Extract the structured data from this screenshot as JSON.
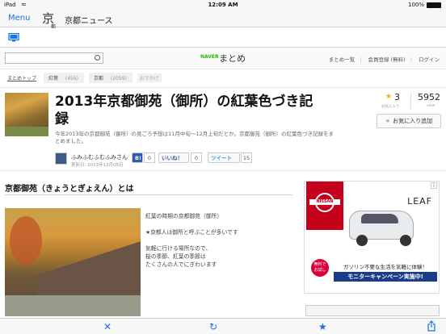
{
  "status": {
    "carrier": "iPad",
    "time": "12:09 AM",
    "battery": "100%"
  },
  "nav": {
    "menu_label": "Menu",
    "logo_char": "京",
    "logo_sub": "都",
    "title": "京都ニュース"
  },
  "naver": {
    "search_placeholder": "",
    "brand": "NAVER",
    "matome": "まとめ",
    "links": [
      "まとめ一覧",
      "会員登録 (無料)",
      "ログイン"
    ]
  },
  "breadcrumb": {
    "top": "まとめトップ",
    "tags": [
      {
        "label": "紅葉",
        "count": "(456)"
      },
      {
        "label": "京都",
        "count": "(2059)"
      }
    ],
    "more": "おでかけ"
  },
  "article": {
    "title": "2013年京都御苑（御所）の紅葉色づき記録",
    "description": "今年2013年の京都御苑（御所）の見ごろ予想は11月中旬〜12月上旬だとか。京都御苑（御所）の紅葉色づき記録をまとめました。",
    "author": "ふみふむふむふみさん",
    "date": "更新日: 2013年12月05日",
    "hatena_label": "B!",
    "hatena_count": "0",
    "facebook_label": "いいね！",
    "facebook_count": "0",
    "tweet_label": "ツイート",
    "tweet_count": "15",
    "fav_count": "3",
    "fav_label": "お気に入り",
    "views": "5952",
    "views_label": "view",
    "fav_button": "お気に入り追加"
  },
  "section": {
    "title": "京都御苑（きょうとぎょえん）とは",
    "paragraphs": [
      "紅葉の時期の京都御苑（御所）",
      "★京都人は御所と呼ぶことが多いです",
      "気軽に行ける場所なので、\n桜の季節、紅葉の季節は\nたくさんの人でにぎわいます"
    ]
  },
  "ad": {
    "brand": "NISSAN",
    "model": "LEAF",
    "free_badge": "無料で\nお試し",
    "catch": "ガソリン不要な生活を気軽に体験！",
    "campaign": "モニターキャンペーン実施中!",
    "info": "i"
  },
  "colors": {
    "accent": "#1a73e8",
    "naver_green": "#2db400",
    "nissan_red": "#c4001a"
  }
}
